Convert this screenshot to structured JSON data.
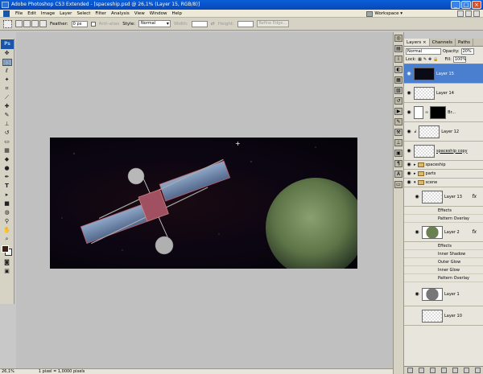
{
  "window": {
    "title": "Adobe Photoshop CS3 Extended - [spaceship.psd @ 26,1% (Layer 15, RGB/8)]"
  },
  "menu": [
    "File",
    "Edit",
    "Image",
    "Layer",
    "Select",
    "Filter",
    "Analysis",
    "View",
    "Window",
    "Help"
  ],
  "workspace_label": "Workspace ▾",
  "options": {
    "feather_label": "Feather:",
    "feather_value": "0 px",
    "antialias_label": "Anti-alias",
    "style_label": "Style:",
    "style_value": "Normal",
    "width_label": "Width:",
    "height_label": "Height:",
    "refine_label": "Refine Edge..."
  },
  "toolbox": {
    "logo": "Ps"
  },
  "status": {
    "zoom": "26,1%",
    "info": "1 pixel = 1,0000 pixels"
  },
  "panel": {
    "tabs": [
      "Layers ×",
      "Channels",
      "Paths"
    ],
    "blend": "Normal",
    "opacity_label": "Opacity:",
    "opacity_value": "20%",
    "lock_label": "Lock:",
    "fill_label": "Fill:",
    "fill_value": "100%"
  },
  "layers": {
    "l15": "Layer 15",
    "l14": "Layer 14",
    "br": "Br...",
    "l12": "Layer 12",
    "spaceship_copy": "spaceship copy",
    "g_spaceship": "spaceship",
    "g_parts": "parts",
    "g_scene": "scene",
    "l13": "Layer 13",
    "effects": "Effects",
    "pattern_overlay": "Pattern Overlay",
    "l2": "Layer 2",
    "effects2": "Effects",
    "inner_shadow": "Inner Shadow",
    "outer_glow": "Outer Glow",
    "inner_glow": "Inner Glow",
    "pattern_overlay2": "Pattern Overlay",
    "l1": "Layer 1",
    "l10": "Layer 10"
  }
}
